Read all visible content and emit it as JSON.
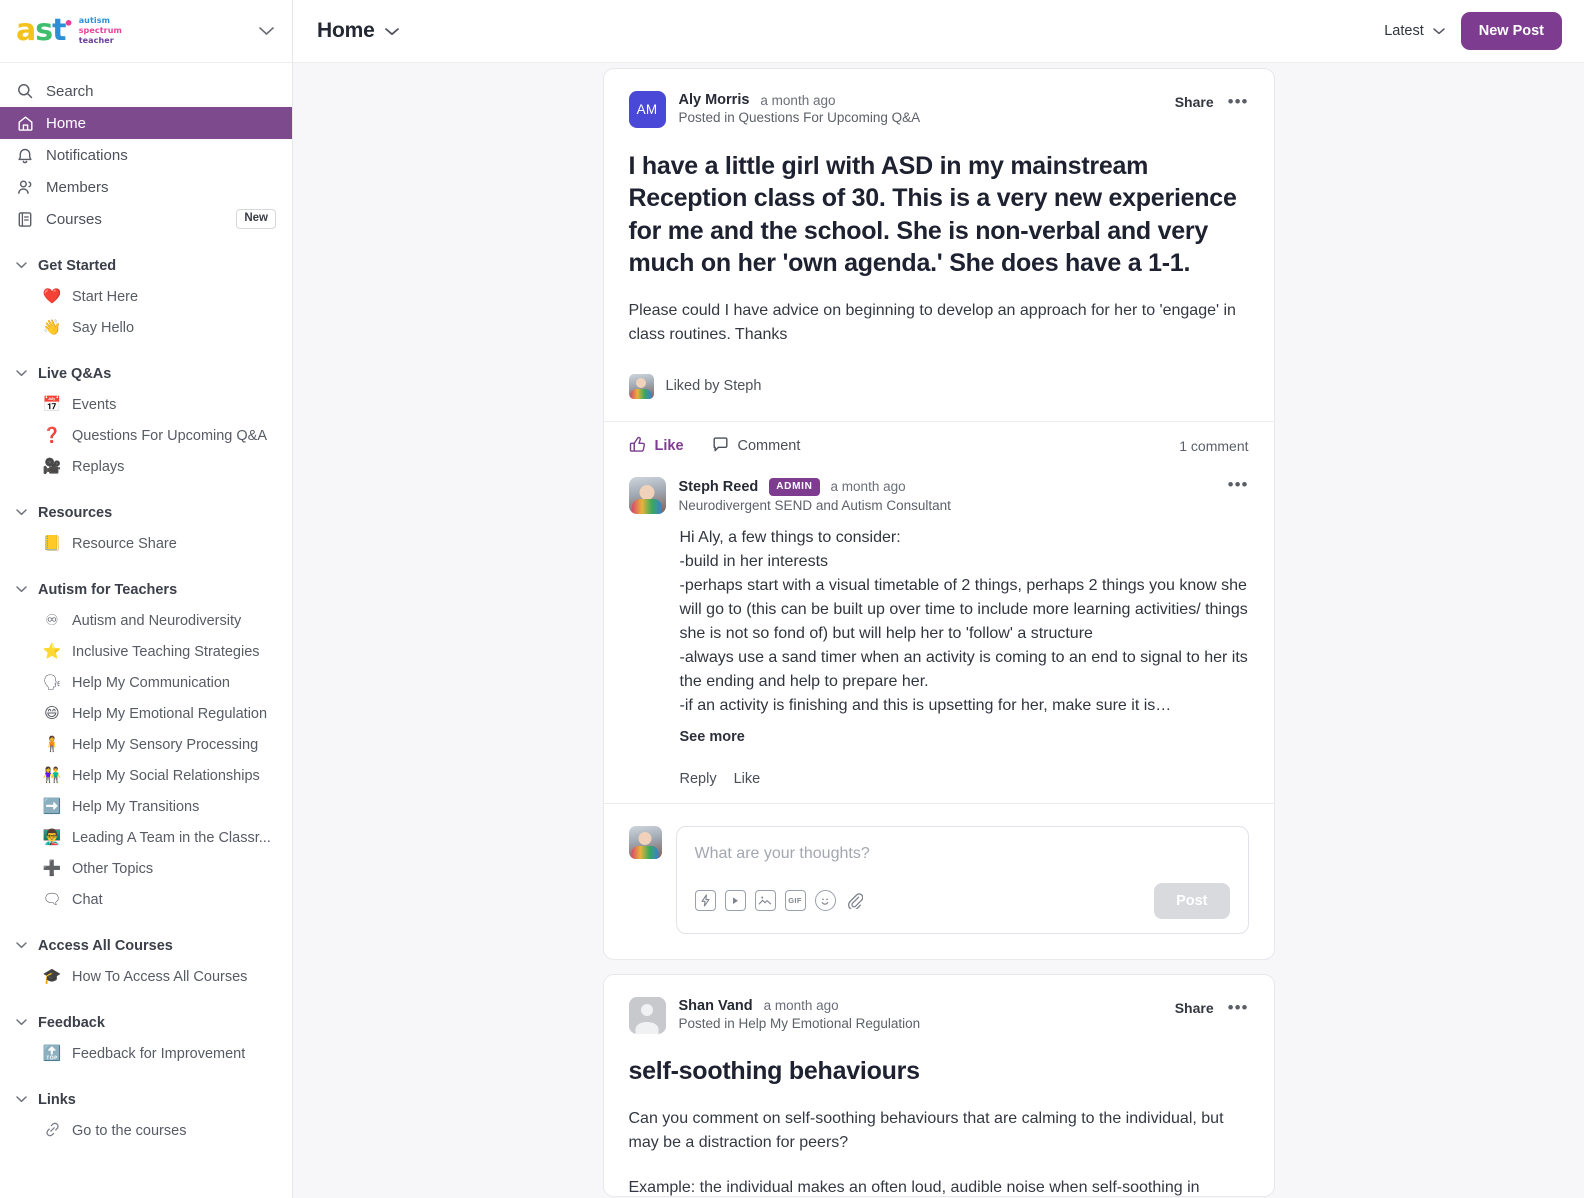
{
  "brand": {
    "logo_letters": [
      "a",
      "s",
      "t"
    ],
    "logo_words": [
      "autism",
      "spectrum",
      "teacher"
    ],
    "collapse_icon": "chevron-down-icon",
    "accent_purple": "#7d3c8f",
    "sidebar_active_purple": "#7e4a8e"
  },
  "sidebar": {
    "primary": [
      {
        "label": "Search",
        "icon": "search-icon",
        "active": false
      },
      {
        "label": "Home",
        "icon": "home-icon",
        "active": true
      },
      {
        "label": "Notifications",
        "icon": "bell-icon",
        "active": false
      },
      {
        "label": "Members",
        "icon": "people-icon",
        "active": false
      },
      {
        "label": "Courses",
        "icon": "book-icon",
        "active": false,
        "badge": "New"
      }
    ],
    "groups": [
      {
        "label": "Get Started",
        "items": [
          {
            "emoji": "❤️",
            "label": "Start Here"
          },
          {
            "emoji": "👋",
            "label": "Say Hello"
          }
        ]
      },
      {
        "label": "Live Q&As",
        "items": [
          {
            "emoji": "📅",
            "label": "Events"
          },
          {
            "emoji": "❓",
            "label": "Questions For Upcoming Q&A"
          },
          {
            "emoji": "🎥",
            "label": "Replays"
          }
        ]
      },
      {
        "label": "Resources",
        "items": [
          {
            "emoji": "📒",
            "label": "Resource Share"
          }
        ]
      },
      {
        "label": "Autism for Teachers",
        "items": [
          {
            "emoji": "♾",
            "label": "Autism and Neurodiversity"
          },
          {
            "emoji": "⭐",
            "label": "Inclusive Teaching Strategies"
          },
          {
            "emoji": "🗣",
            "label": "Help My Communication"
          },
          {
            "emoji": "😄",
            "label": "Help My Emotional Regulation"
          },
          {
            "emoji": "🧍",
            "label": "Help My Sensory Processing"
          },
          {
            "emoji": "👫",
            "label": "Help My Social Relationships"
          },
          {
            "emoji": "➡️",
            "label": "Help My Transitions"
          },
          {
            "emoji": "👨‍🏫",
            "label": "Leading A Team in the Classr..."
          },
          {
            "emoji": "➕",
            "label": "Other Topics"
          },
          {
            "emoji": "🗨",
            "label": "Chat"
          }
        ]
      },
      {
        "label": "Access All Courses",
        "items": [
          {
            "emoji": "🎓",
            "label": "How To Access All Courses"
          }
        ]
      },
      {
        "label": "Feedback",
        "items": [
          {
            "emoji": "🔝",
            "label": "Feedback for Improvement"
          }
        ]
      },
      {
        "label": "Links",
        "items": [
          {
            "emoji": "🔗",
            "label": "Go to the courses"
          }
        ]
      }
    ]
  },
  "topbar": {
    "title": "Home",
    "title_chevron": "chevron-down-icon",
    "sort_label": "Latest",
    "sort_chevron": "chevron-down-icon",
    "new_post_label": "New Post"
  },
  "posts": [
    {
      "author": "Aly Morris",
      "avatar_initials": "AM",
      "avatar_style": "indigo",
      "timestamp": "a month ago",
      "posted_in": "Posted in Questions For Upcoming Q&A",
      "share_label": "Share",
      "more_icon": "ellipsis-icon",
      "title": "I have a little girl with ASD in my mainstream Reception class of 30. This is a very new experience for me and the school. She is non-verbal and very much on her 'own agenda.' She does have a 1-1.",
      "body": "Please could I have advice on beginning to develop an approach for her to 'engage' in class routines. Thanks",
      "liked_by": "Liked by Steph",
      "actions": {
        "like_label": "Like",
        "like_icon": "thumbs-up-icon",
        "liked": true,
        "comment_label": "Comment",
        "comment_icon": "speech-bubble-icon",
        "count_label": "1 comment"
      },
      "comments": [
        {
          "author": "Steph Reed",
          "badge": "ADMIN",
          "timestamp": "a month ago",
          "headline": "Neurodivergent SEND and Autism Consultant",
          "more_icon": "ellipsis-icon",
          "text": "Hi Aly, a few things to consider:\n-build in her interests\n-perhaps start with a visual timetable of 2 things, perhaps 2 things you know she will go to (this can be built up over time to include more learning activities/ things she is not so fond of) but will help her to 'follow' a structure\n-always use a sand timer when an activity is coming to an end to signal to her its the ending and help to prepare her.\n-if an activity is finishing and this is upsetting for her, make sure it is…",
          "see_more": "See more",
          "reply_label": "Reply",
          "like_label": "Like"
        }
      ],
      "composer": {
        "placeholder": "What are your thoughts?",
        "value": "",
        "post_label": "Post",
        "tools": [
          {
            "icon": "lightning-icon",
            "glyph": "⚡"
          },
          {
            "icon": "video-icon",
            "glyph": "▶"
          },
          {
            "icon": "image-icon",
            "glyph": "🖼"
          },
          {
            "icon": "gif-icon",
            "glyph": "GIF"
          },
          {
            "icon": "emoji-icon",
            "glyph": "☺"
          },
          {
            "icon": "attachment-icon",
            "glyph": "📎"
          }
        ]
      }
    },
    {
      "author": "Shan Vand",
      "avatar_initials": "",
      "avatar_style": "gray",
      "timestamp": "a month ago",
      "posted_in": "Posted in Help My Emotional Regulation",
      "share_label": "Share",
      "more_icon": "ellipsis-icon",
      "title": "self-soothing behaviours",
      "body": "Can you comment on self-soothing behaviours that are calming to the individual, but may be a distraction for peers?",
      "body_cut": "Example: the individual makes an often loud, audible noise when self-soothing in"
    }
  ]
}
